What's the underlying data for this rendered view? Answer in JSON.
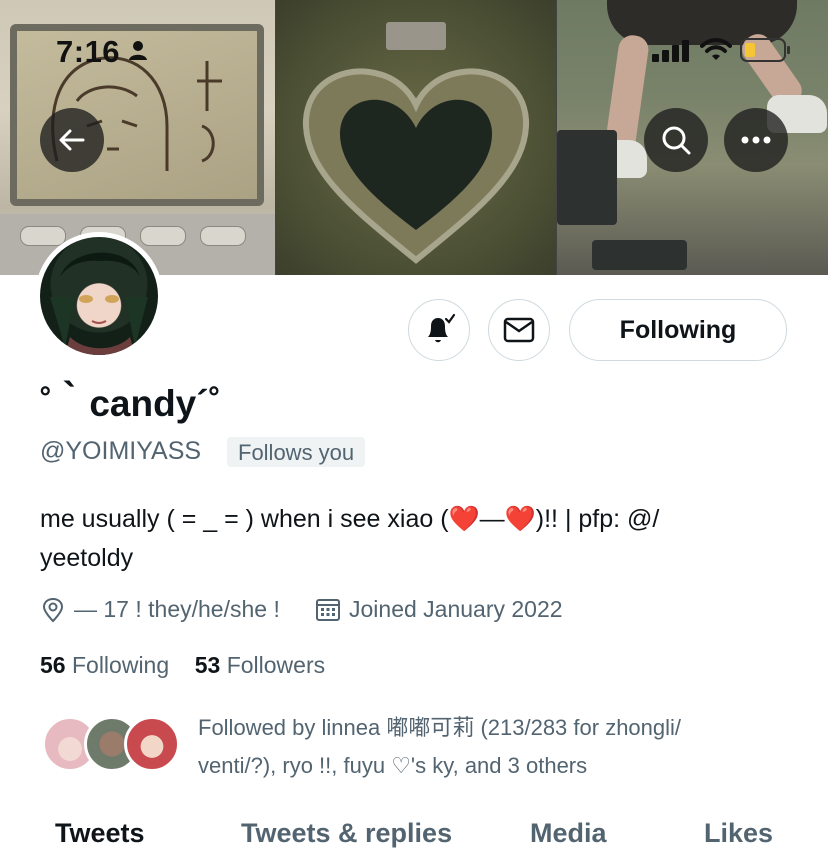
{
  "status_bar": {
    "time": "7:16"
  },
  "header": {
    "back_icon": "arrow-left-icon",
    "search_icon": "search-icon",
    "more_icon": "more-horizontal-icon"
  },
  "profile": {
    "name": "˚｀candy´˚",
    "handle": "@YOIMIYASS",
    "follows_you": "Follows you",
    "bio_line1": "me usually ( = _ = ) when i see xiao (❤️—❤️)!! | pfp: @/",
    "bio_line2": "yeetoldy",
    "location": "— 17 ! they/he/she !",
    "joined": "Joined January 2022",
    "following_count": "56",
    "following_label": "Following",
    "followers_count": "53",
    "followers_label": "Followers"
  },
  "actions": {
    "notify_icon": "bell-check-icon",
    "message_icon": "envelope-icon",
    "following_button": "Following"
  },
  "followed_by": {
    "line1": "Followed by linnea 嘟嘟可莉 (213/283 for zhongli/",
    "line2": "venti/?), ryo !!, fuyu ♡'s ky, and 3 others"
  },
  "tabs": [
    {
      "label": "Tweets"
    },
    {
      "label": "Tweets & replies"
    },
    {
      "label": "Media"
    },
    {
      "label": "Likes"
    }
  ],
  "colors": {
    "accent_text": "#0f1419",
    "secondary_text": "#536471",
    "border": "#cfd9de"
  }
}
